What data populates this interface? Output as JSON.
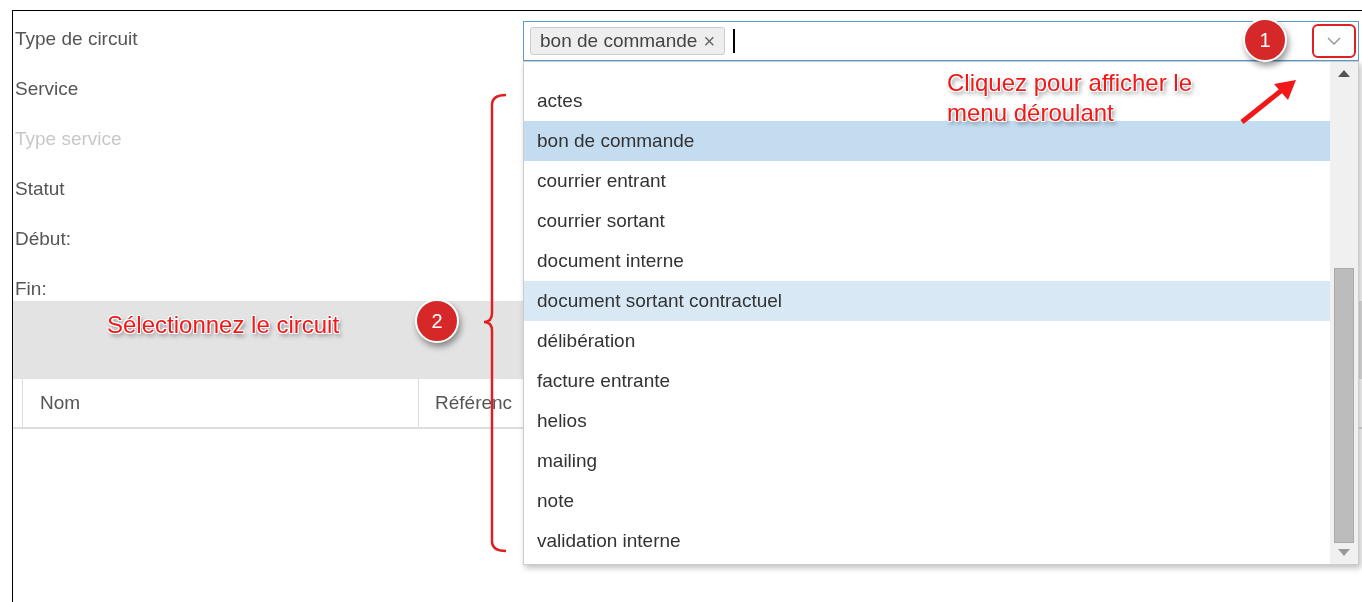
{
  "form": {
    "fields": [
      {
        "label": "Type de circuit",
        "disabled": false
      },
      {
        "label": "Service",
        "disabled": false
      },
      {
        "label": "Type service",
        "disabled": true
      },
      {
        "label": "Statut",
        "disabled": false
      },
      {
        "label": "Début:",
        "disabled": false
      },
      {
        "label": "Fin:",
        "disabled": false
      }
    ]
  },
  "circuit_select": {
    "tags": [
      "bon de commande"
    ],
    "remove_symbol": "×",
    "expanded": true,
    "options": [
      {
        "label": "actes",
        "selected": false,
        "highlighted": false
      },
      {
        "label": "bon de commande",
        "selected": true,
        "highlighted": false
      },
      {
        "label": "courrier entrant",
        "selected": false,
        "highlighted": false
      },
      {
        "label": "courrier sortant",
        "selected": false,
        "highlighted": false
      },
      {
        "label": "document interne",
        "selected": false,
        "highlighted": false
      },
      {
        "label": "document sortant contractuel",
        "selected": false,
        "highlighted": true
      },
      {
        "label": "délibération",
        "selected": false,
        "highlighted": false
      },
      {
        "label": "facture entrante",
        "selected": false,
        "highlighted": false
      },
      {
        "label": "helios",
        "selected": false,
        "highlighted": false
      },
      {
        "label": "mailing",
        "selected": false,
        "highlighted": false
      },
      {
        "label": "note",
        "selected": false,
        "highlighted": false
      },
      {
        "label": "validation interne",
        "selected": false,
        "highlighted": false
      }
    ]
  },
  "table": {
    "columns": [
      "Nom",
      "Référenc"
    ]
  },
  "annotations": [
    {
      "number": "1",
      "text": "Cliquez pour afficher le menu déroulant"
    },
    {
      "number": "2",
      "text": "Sélectionnez le circuit"
    }
  ]
}
